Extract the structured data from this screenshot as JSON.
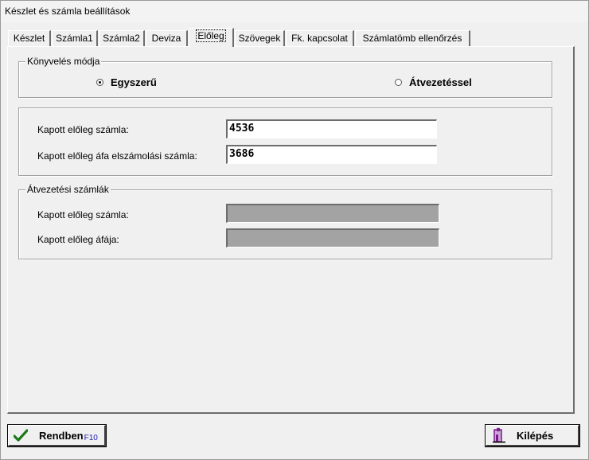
{
  "window": {
    "title": "Készlet és számla beállítások"
  },
  "tabs": [
    {
      "label": "Készlet"
    },
    {
      "label": "Számla1"
    },
    {
      "label": "Számla2"
    },
    {
      "label": "Deviza"
    },
    {
      "label": "Előleg",
      "active": true
    },
    {
      "label": "Szövegek"
    },
    {
      "label": "Fk. kapcsolat"
    },
    {
      "label": "Számlatömb ellenőrzés"
    }
  ],
  "konyveles": {
    "title": "Könyvelés módja",
    "option1": "Egyszerű",
    "option2": "Átvezetéssel",
    "selected": "Egyszerű"
  },
  "accounts": {
    "row1_label": "Kapott előleg számla:",
    "row1_value": "4536",
    "row2_label": "Kapott előleg áfa elszámolási számla:",
    "row2_value": "3686"
  },
  "atvezetesi": {
    "title": "Átvezetési számlák",
    "row1_label": "Kapott előleg számla:",
    "row1_value": "",
    "row2_label": "Kapott előleg áfája:",
    "row2_value": ""
  },
  "buttons": {
    "ok_label": "Rendben",
    "ok_hotkey": "F10",
    "exit_label": "Kilépés"
  },
  "icons": {
    "ok": "checkmark-icon",
    "exit": "exit-door-icon"
  },
  "colors": {
    "checkmark": "#1a7a1a",
    "exit_icon": "#7a1a8a",
    "disabled_field": "#a3a3a3"
  }
}
